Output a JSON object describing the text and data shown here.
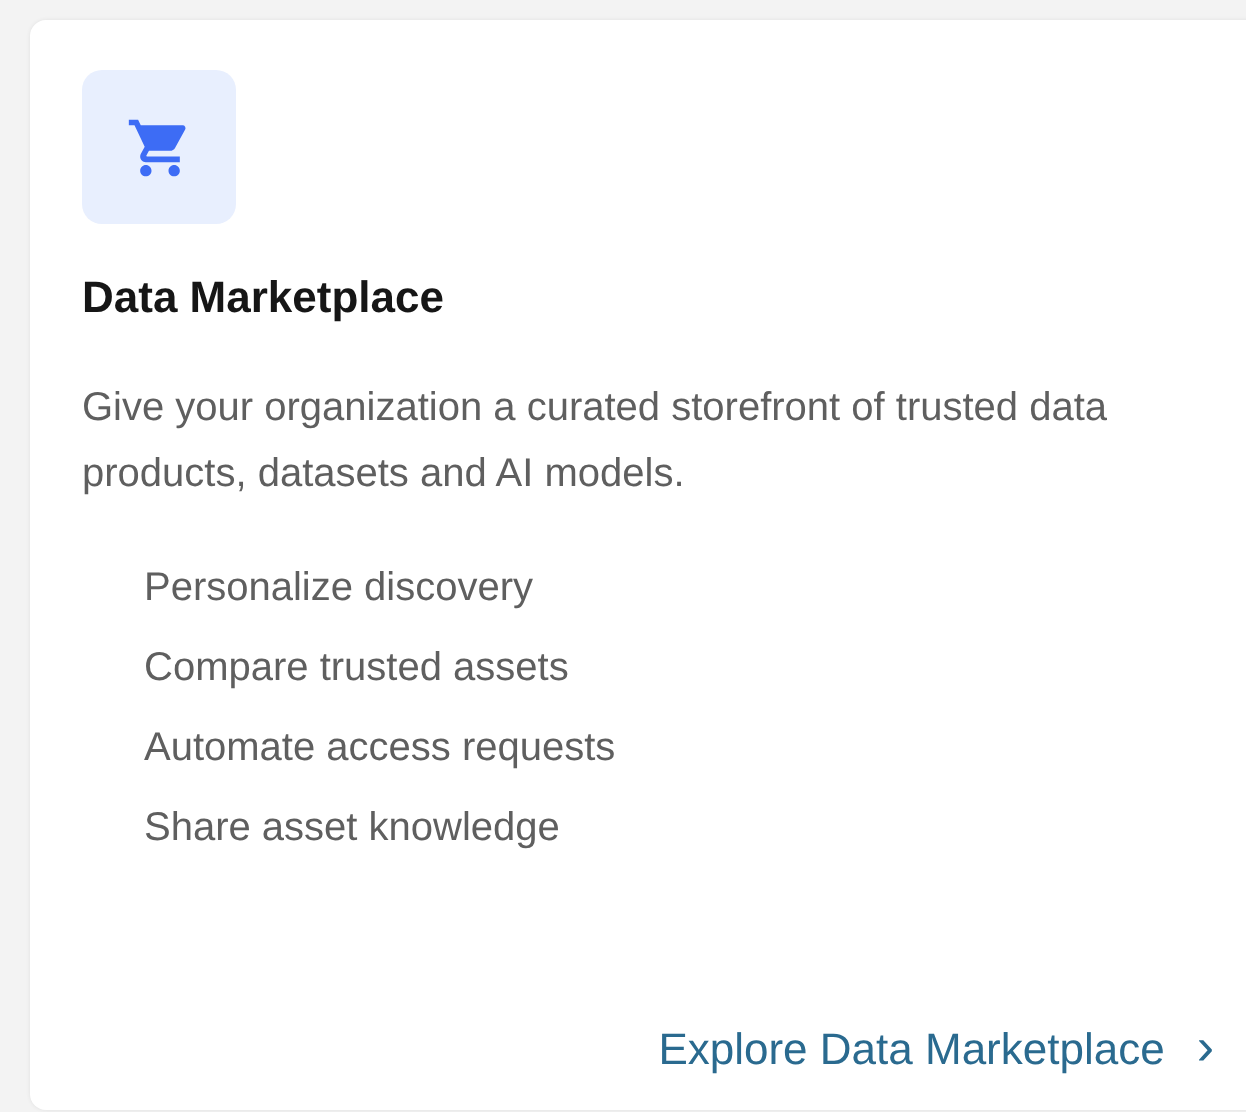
{
  "card": {
    "title": "Data Marketplace",
    "description": "Give your organization a curated storefront of trusted data products, datasets and AI models.",
    "features": [
      "Personalize discovery",
      "Compare trusted assets",
      "Automate access requests",
      "Share asset knowledge"
    ],
    "link": {
      "label": "Explore Data Marketplace",
      "chevron": "›"
    }
  }
}
